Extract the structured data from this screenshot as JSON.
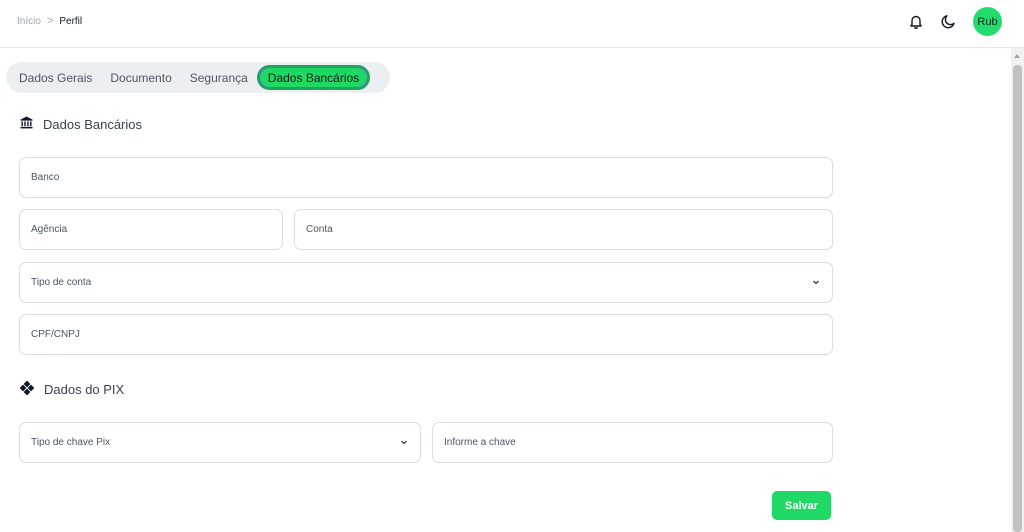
{
  "breadcrumb": {
    "root": "Início",
    "separator": ">",
    "current": "Perfil"
  },
  "header": {
    "avatar_initials": "Rub",
    "bell_icon": "bell-icon",
    "theme_icon": "moon-icon"
  },
  "tabs": [
    {
      "label": "Dados Gerais",
      "active": false
    },
    {
      "label": "Documento",
      "active": false
    },
    {
      "label": "Segurança",
      "active": false
    },
    {
      "label": "Dados Bancários",
      "active": true
    }
  ],
  "sections": {
    "bank": {
      "title": "Dados Bancários",
      "icon": "bank-icon"
    },
    "pix": {
      "title": "Dados do PIX",
      "icon": "pix-icon"
    }
  },
  "form": {
    "banco": {
      "placeholder": "Banco",
      "value": ""
    },
    "agencia": {
      "placeholder": "Agência",
      "value": ""
    },
    "conta": {
      "placeholder": "Conta",
      "value": ""
    },
    "tipo_conta": {
      "placeholder": "Tipo de conta",
      "value": ""
    },
    "cpf_cnpj": {
      "placeholder": "CPF/CNPJ",
      "value": ""
    },
    "tipo_chave_pix": {
      "placeholder": "Tipo de chave Pix",
      "value": ""
    },
    "chave": {
      "placeholder": "Informe a chave",
      "value": ""
    }
  },
  "actions": {
    "save_label": "Salvar"
  },
  "colors": {
    "accent": "#1fd866",
    "border": "#d9dde3",
    "text": "#374151"
  }
}
